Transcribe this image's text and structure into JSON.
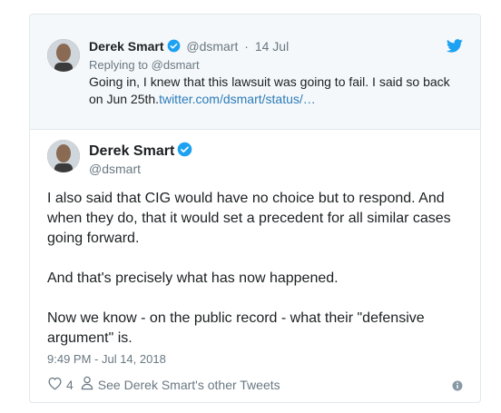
{
  "quoted_tweet": {
    "name": "Derek Smart",
    "handle": "@dsmart",
    "separator": "·",
    "date": "14 Jul",
    "replying_to": "Replying to @dsmart",
    "text": "Going in, I knew that this lawsuit was going to fail. I said so back on Jun 25th.",
    "link": "twitter.com/dsmart/status/…"
  },
  "main_tweet": {
    "name": "Derek Smart",
    "handle": "@dsmart",
    "paragraphs": [
      "I also said that CIG would have no choice but to respond. And when they do, that it would set a precedent for all similar cases going forward.",
      "And that's precisely what has now happened.",
      "Now we know - on the public record - what their \"defensive argument\" is."
    ],
    "timestamp": "9:49 PM - Jul 14, 2018"
  },
  "actions": {
    "like_count": "4",
    "other_tweets_label": "See Derek Smart's other Tweets"
  },
  "colors": {
    "link": "#2b7bb9",
    "verified": "#1da1f2",
    "meta": "#697882",
    "text": "#1c2022"
  },
  "icons": [
    "verified-badge-icon",
    "twitter-bird-icon",
    "heart-icon",
    "person-icon",
    "info-icon"
  ]
}
